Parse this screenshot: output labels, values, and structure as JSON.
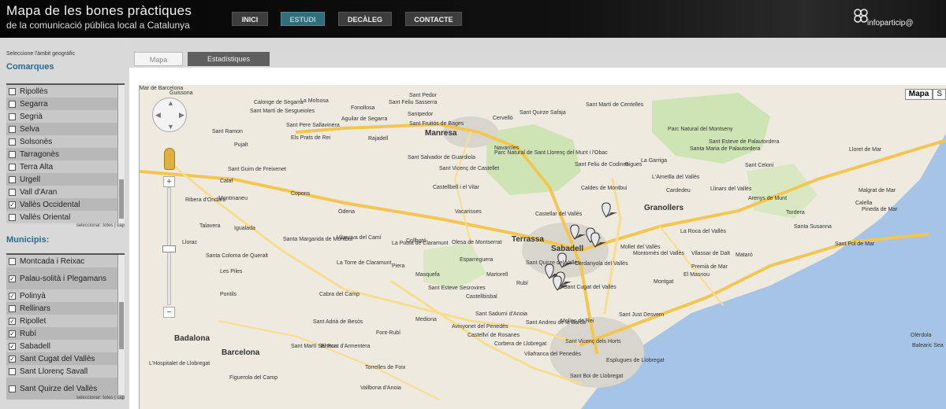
{
  "header": {
    "title": "Mapa de les bones pràctiques",
    "subtitle": "de la comunicació pública local a Catalunya",
    "nav": [
      "INICI",
      "ESTUDI",
      "DECÀLEG",
      "CONTACTE"
    ],
    "active_nav": "ESTUDI",
    "logo_text": "infoparticip@"
  },
  "sidebar": {
    "geo_label": "Seleccione l'àmbit geogràfic",
    "comarques_title": "Comarques",
    "comarques": [
      {
        "label": "Ripollès",
        "checked": false
      },
      {
        "label": "Segarra",
        "checked": false
      },
      {
        "label": "Segrià",
        "checked": false
      },
      {
        "label": "Selva",
        "checked": false
      },
      {
        "label": "Solsonès",
        "checked": false
      },
      {
        "label": "Tarragonès",
        "checked": false
      },
      {
        "label": "Terra Alta",
        "checked": false
      },
      {
        "label": "Urgell",
        "checked": false
      },
      {
        "label": "Vall d'Aran",
        "checked": false
      },
      {
        "label": "Vallès Occidental",
        "checked": true
      },
      {
        "label": "Vallès Oriental",
        "checked": false
      }
    ],
    "comarques_select": "seleccionar: totes | cap",
    "municipis_title": "Municipis:",
    "municipis": [
      {
        "label": "Montcada i Reixac",
        "checked": false
      },
      {
        "label": "Palau-solità i Plegamans",
        "checked": true
      },
      {
        "label": "Polinyà",
        "checked": true
      },
      {
        "label": "Rellinars",
        "checked": false
      },
      {
        "label": "Ripollet",
        "checked": true
      },
      {
        "label": "Rubí",
        "checked": true
      },
      {
        "label": "Sabadell",
        "checked": true
      },
      {
        "label": "Sant Cugat del Vallès",
        "checked": true
      },
      {
        "label": "Sant Llorenç Savall",
        "checked": false
      },
      {
        "label": "Sant Quirze del Vallès",
        "checked": false
      }
    ],
    "municipis_select": "seleccionar: totes | cap"
  },
  "tabs": {
    "map": "Mapa",
    "stats": "Estadístiques"
  },
  "map": {
    "type_buttons": [
      "Mapa",
      "S"
    ],
    "zoom_in": "+",
    "zoom_out": "−",
    "places": [
      "Guissona",
      "Calonge de Segarra",
      "La Molsosa",
      "Fonollosa",
      "Sant Feliu Sasserra",
      "Sant Pedor",
      "Sant Martí de Centelles",
      "Sant Martí de Sesgueioles",
      "Sant Pere Sallavinera",
      "Aguilar de Segarra",
      "Santpedor",
      "Sant Fruitós de Bages",
      "Sant Quirze Safaja",
      "Parc Natural del Montseny",
      "Els Prats de Rei",
      "Manresa",
      "Navarcles",
      "Cervelló",
      "Sant Ramon",
      "Pujalt",
      "Rajadell",
      "Sant Salvador de Guardiola",
      "Parc Natural de Sant Llorenç del Munt i l'Obac",
      "Sant Feliu de Codines",
      "Sant Esteve de Palautordera",
      "Santa Maria de Palautordera",
      "Sant Celoni",
      "Lloret de Mar",
      "Sant Guim de Freixenet",
      "Calaf",
      "Castellbell i el Vilar",
      "Sant Vicenç de Castellet",
      "Caldes de Montbui",
      "Bigues",
      "La Garriga",
      "L'Ametlla del Vallès",
      "Cardedeu",
      "Llinars del Vallès",
      "Arenys de Munt",
      "Malgrat de Mar",
      "Montmaneu",
      "Copons",
      "Òdena",
      "Vacarisses",
      "Castellar del Vallès",
      "Granollers",
      "Tordera",
      "Pineda de Mar",
      "Calella",
      "Ribera d'Ondara",
      "Talavera",
      "Igualada",
      "Collbató",
      "Olesa de Montserrat",
      "Terrassa",
      "Sabadell",
      "Mollet del Vallès",
      "La Roca del Vallès",
      "Santa Susanna",
      "Sant Pol de Mar",
      "Santa Margarida de Montbui",
      "Vilanova del Camí",
      "La Pobla de Claramunt",
      "Esparreguera",
      "Sant Quirze del Vallès",
      "Cerdanyola del Vallès",
      "Montornès del Vallès",
      "Vilassar de Dalt",
      "Mataró",
      "Santa Coloma de Queralt",
      "Llorac",
      "La Torre de Claramunt",
      "Piera",
      "Masquefa",
      "Martorell",
      "Rubí",
      "Sant Cugat del Vallès",
      "Montgat",
      "Premià de Mar",
      "El Masnou",
      "Les Piles",
      "Pontils",
      "Sant Esteve Sesrovires",
      "Castellbisbal",
      "Badalona",
      "Cabra del Camp",
      "Mediona",
      "Sant Sadurní d'Anoia",
      "Sant Andreu de la Barca",
      "Molins de Rei",
      "Sant Just Desvern",
      "Sant Adrià de Besòs",
      "Font-Rubí",
      "Avinyonet del Penedès",
      "Castellví de Rosanes",
      "Corbera de Llobregat",
      "Sant Vicenç dels Horts",
      "Esplugues de Llobregat",
      "Barcelona",
      "El Pont d'Armentera",
      "Sant Martí Sarroca",
      "Torrelles de Foix",
      "Vilafranca del Penedès",
      "Sant Boi de Llobregat",
      "L'Hospitalet de Llobregat",
      "Figuerola del Camp",
      "Vallbona d'Anoia",
      "Olèrdola",
      "Balearic Sea",
      "Mar de Barcelona"
    ]
  },
  "colors": {
    "accent": "#2b6b8a",
    "active_nav": "#336c7a",
    "sea": "#a6c4e6",
    "park": "#cfe4b4",
    "highway": "#f3c651",
    "road": "#f7dd8f",
    "urban": "#d8d5cc"
  }
}
